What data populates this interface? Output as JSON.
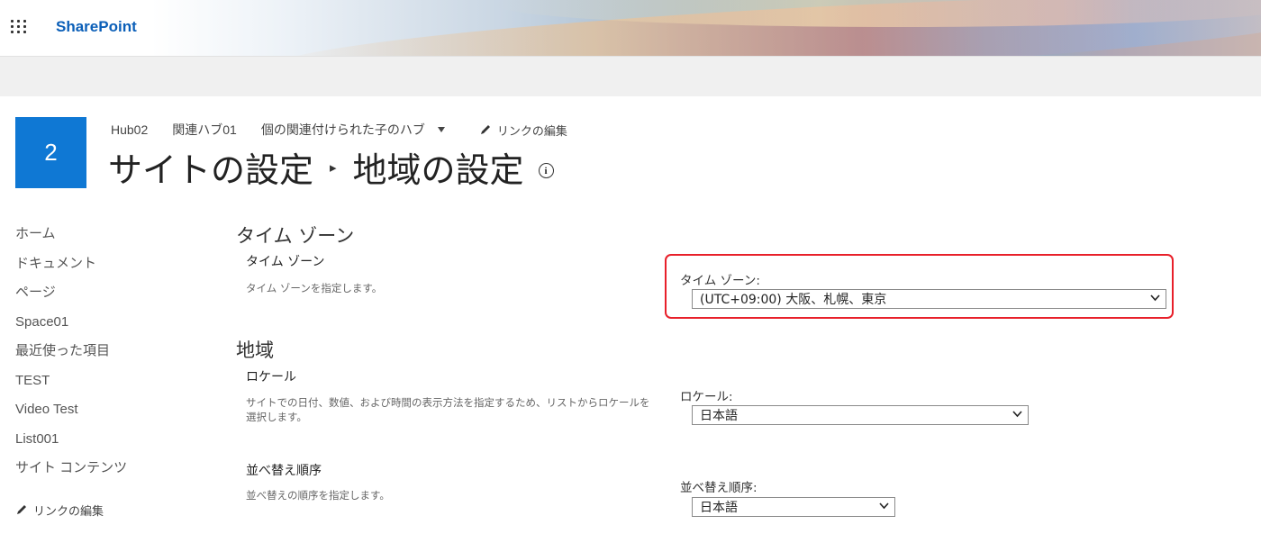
{
  "header": {
    "app_name": "SharePoint",
    "waffle_icon": "app-launcher-icon"
  },
  "site": {
    "logo_text": "2",
    "logo_color": "#0f78d4"
  },
  "topnav": {
    "items": [
      "Hub02",
      "関連ハブ01",
      "個の関連付けられた子のハブ"
    ],
    "edit_links": "リンクの編集"
  },
  "title": {
    "parent": "サイトの設定",
    "current": "地域の設定",
    "info_glyph": "i"
  },
  "leftnav": {
    "items": [
      "ホーム",
      "ドキュメント",
      "ページ",
      "Space01",
      "最近使った項目",
      "TEST",
      "Video Test",
      "List001",
      "サイト コンテンツ"
    ],
    "edit_links": "リンクの編集"
  },
  "sections": {
    "timezone": {
      "heading": "タイム ゾーン",
      "field_title": "タイム ゾーン",
      "description": "タイム ゾーンを指定します。",
      "label": "タイム ゾーン:",
      "value": "(UTC+09:00) 大阪、札幌、東京"
    },
    "region": {
      "heading": "地域",
      "locale": {
        "field_title": "ロケール",
        "description": "サイトでの日付、数値、および時間の表示方法を指定するため、リストからロケールを選択します。",
        "label": "ロケール:",
        "value": "日本語"
      },
      "sort": {
        "field_title": "並べ替え順序",
        "description": "並べ替えの順序を指定します。",
        "label": "並べ替え順序:",
        "value": "日本語"
      }
    }
  },
  "colors": {
    "brand": "#0b5fb8",
    "highlight": "#e8202a"
  }
}
